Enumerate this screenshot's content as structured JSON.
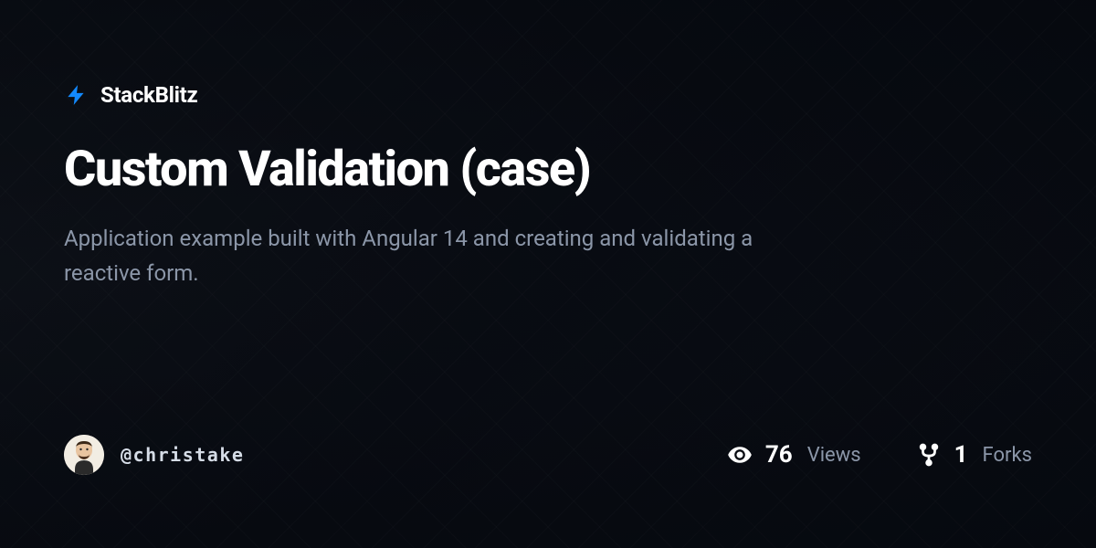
{
  "brand": {
    "name": "StackBlitz",
    "accent_color": "#1389FD"
  },
  "project": {
    "title": "Custom Validation (case)",
    "description": "Application example built with Angular 14 and creating and validating a reactive form."
  },
  "author": {
    "username": "@christake"
  },
  "stats": {
    "views": {
      "value": "76",
      "label": "Views"
    },
    "forks": {
      "value": "1",
      "label": "Forks"
    }
  }
}
